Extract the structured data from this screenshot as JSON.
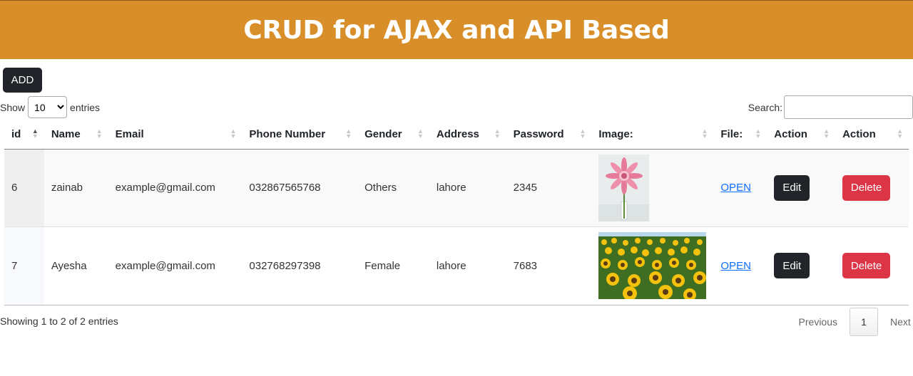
{
  "header": {
    "title": "CRUD for AJAX and API Based",
    "bg_color": "#d98f29"
  },
  "toolbar": {
    "add_label": "ADD"
  },
  "length": {
    "prefix": "Show",
    "selected": "10",
    "suffix": "entries",
    "options": [
      "10"
    ]
  },
  "search": {
    "label": "Search:",
    "value": ""
  },
  "table": {
    "columns": [
      "id",
      "Name",
      "Email",
      "Phone Number",
      "Gender",
      "Address",
      "Password",
      "Image:",
      "File:",
      "Action",
      "Action"
    ],
    "sorted_column": "id",
    "sort_direction": "ascending",
    "rows": [
      {
        "id": "6",
        "name": "zainab",
        "email": "example@gmail.com",
        "phone": "032867565768",
        "gender": "Others",
        "address": "lahore",
        "password": "2345",
        "image": "pink-gerbera-flower-icon",
        "file_link": "OPEN",
        "edit": "Edit",
        "delete": "Delete"
      },
      {
        "id": "7",
        "name": "Ayesha",
        "email": "example@gmail.com",
        "phone": "032768297398",
        "gender": "Female",
        "address": "lahore",
        "password": "7683",
        "image": "sunflower-field-icon",
        "file_link": "OPEN",
        "edit": "Edit",
        "delete": "Delete"
      }
    ]
  },
  "footer": {
    "info": "Showing 1 to 2 of 2 entries",
    "previous": "Previous",
    "current_page": "1",
    "next": "Next"
  },
  "colors": {
    "dark_button": "#212529",
    "danger_button": "#dc3545",
    "link": "#0d6efd"
  }
}
